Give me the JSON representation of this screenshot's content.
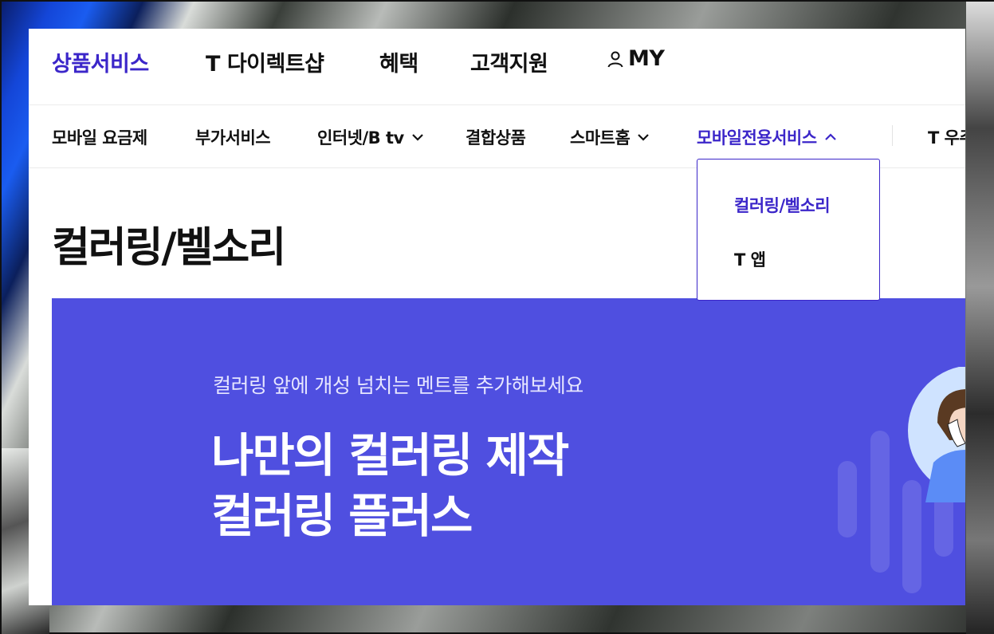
{
  "top_nav": {
    "items": [
      "상품서비스",
      "T 다이렉트샵",
      "혜택",
      "고객지원"
    ],
    "my_label": "MY",
    "active_color": "#3b26c9"
  },
  "sub_nav": {
    "items": [
      "모바일 요금제",
      "부가서비스",
      "인터넷/B tv",
      "결합상품",
      "스마트홈",
      "모바일전용서비스"
    ],
    "cut_item": "T 우주"
  },
  "dropdown": {
    "items": [
      "컬러링/벨소리",
      "T 앱"
    ]
  },
  "page": {
    "title": "컬러링/벨소리"
  },
  "banner": {
    "subtitle": "컬러링 앞에 개성 넘치는 멘트를 추가해보세요",
    "headline_line1": "나만의 컬러링 제작",
    "headline_line2": "컬러링 플러스",
    "background": "#4f4fe0"
  }
}
